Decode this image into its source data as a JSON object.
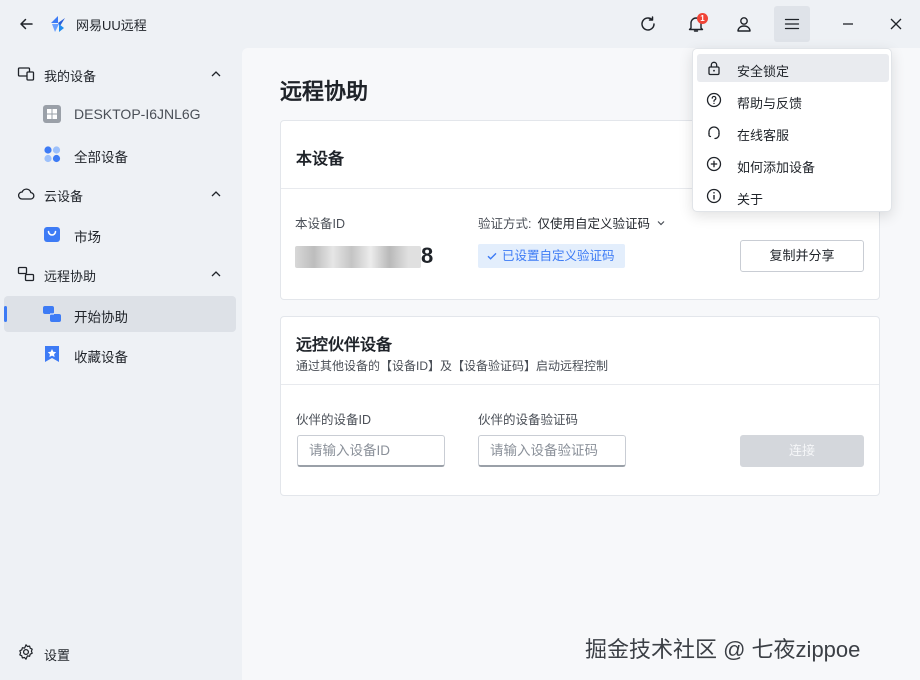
{
  "app": {
    "title": "网易UU远程"
  },
  "titlebar": {
    "notification_count": "1"
  },
  "sidebar": {
    "groups": [
      {
        "label": "我的设备",
        "items": [
          {
            "label": "DESKTOP-I6JNL6G"
          },
          {
            "label": "全部设备"
          }
        ]
      },
      {
        "label": "云设备",
        "items": [
          {
            "label": "市场"
          }
        ]
      },
      {
        "label": "远程协助",
        "items": [
          {
            "label": "开始协助"
          },
          {
            "label": "收藏设备"
          }
        ]
      }
    ],
    "settings_label": "设置"
  },
  "main": {
    "page_title": "远程协助",
    "this_device": {
      "title": "本设备",
      "id_label": "本设备ID",
      "id_value_visible": "8",
      "verify_label": "验证方式:",
      "verify_value": "仅使用自定义验证码",
      "tag": "已设置自定义验证码",
      "copy_button": "复制并分享"
    },
    "partner": {
      "title": "远控伙伴设备",
      "subtitle": "通过其他设备的【设备ID】及【设备验证码】启动远程控制",
      "id_label": "伙伴的设备ID",
      "id_placeholder": "请输入设备ID",
      "code_label": "伙伴的设备验证码",
      "code_placeholder": "请输入设备验证码",
      "connect_button": "连接"
    }
  },
  "menu": {
    "items": [
      {
        "label": "安全锁定",
        "icon": "lock-icon"
      },
      {
        "label": "帮助与反馈",
        "icon": "help-icon"
      },
      {
        "label": "在线客服",
        "icon": "headset-icon"
      },
      {
        "label": "如何添加设备",
        "icon": "add-circle-icon"
      },
      {
        "label": "关于",
        "icon": "info-icon"
      }
    ]
  },
  "watermark": "掘金技术社区 @ 七夜zippoe",
  "colors": {
    "accent": "#3d7bf5",
    "badge": "#f04437",
    "tag_bg": "#e3eefc"
  }
}
